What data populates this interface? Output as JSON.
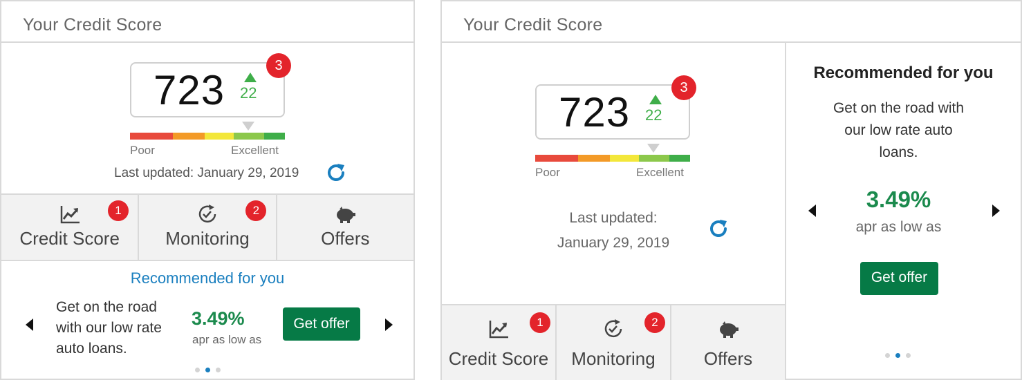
{
  "colors": {
    "accent": "#1a7fbf",
    "positive": "#3fae49",
    "rate": "#1b8a4d",
    "offer_button": "#067a46",
    "notification": "#e3242b",
    "meter": [
      "#e84a3c",
      "#f39a27",
      "#f3e73a",
      "#8cc84b",
      "#3fae49"
    ]
  },
  "widgets": [
    {
      "title": "Your Credit Score",
      "score": {
        "value": "723",
        "delta": "22",
        "delta_direction": "up",
        "notification_count": "3",
        "meter_low_label": "Poor",
        "meter_high_label": "Excellent"
      },
      "last_updated": "Last updated: January 29, 2019",
      "refresh_icon": "refresh-icon",
      "tabs": [
        {
          "label": "Credit Score",
          "icon": "chart-icon",
          "badge": "1"
        },
        {
          "label": "Monitoring",
          "icon": "monitoring-icon",
          "badge": "2"
        },
        {
          "label": "Offers",
          "icon": "piggy-bank-icon",
          "badge": ""
        }
      ],
      "recommendation": {
        "title": "Recommended for you",
        "text_lines": [
          "Get on the road",
          "with our low rate",
          "auto loans."
        ],
        "rate": "3.49%",
        "rate_label": "apr as low as",
        "button": "Get offer",
        "carousel_pages": 3,
        "active_page": 2
      }
    },
    {
      "title": "Your Credit Score",
      "score": {
        "value": "723",
        "delta": "22",
        "delta_direction": "up",
        "notification_count": "3",
        "meter_low_label": "Poor",
        "meter_high_label": "Excellent"
      },
      "last_updated_lines": [
        "Last updated:",
        "January 29, 2019"
      ],
      "refresh_icon": "refresh-icon",
      "tabs": [
        {
          "label": "Credit Score",
          "icon": "chart-icon",
          "badge": "1"
        },
        {
          "label": "Monitoring",
          "icon": "monitoring-icon",
          "badge": "2"
        },
        {
          "label": "Offers",
          "icon": "piggy-bank-icon",
          "badge": ""
        }
      ],
      "recommendation": {
        "title": "Recommended for you",
        "text_lines": [
          "Get on the road with",
          "our low rate auto",
          "loans."
        ],
        "rate": "3.49%",
        "rate_label": "apr as low as",
        "button": "Get offer",
        "carousel_pages": 3,
        "active_page": 2
      }
    }
  ]
}
